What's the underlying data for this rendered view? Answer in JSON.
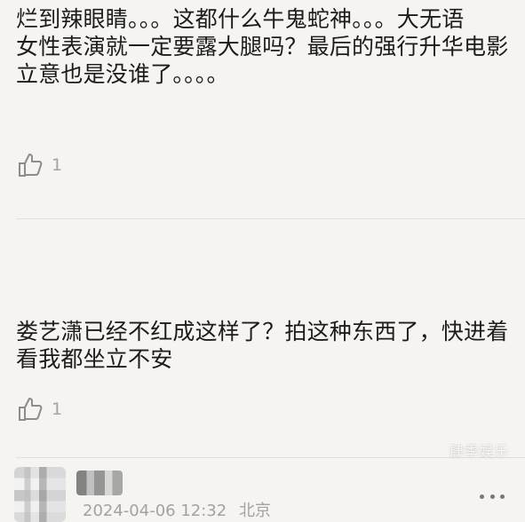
{
  "comments": [
    {
      "text": "烂到辣眼睛。。。这都什么牛鬼蛇神。。。大无语\n女性表演就一定要露大腿吗？最后的强行升华电影立意也是没谁了。。。。",
      "like_count": "1",
      "like_icon": "thumb-up-icon"
    },
    {
      "user": {
        "timestamp": "2024-04-06 12:32",
        "location": "北京"
      },
      "text": "娄艺潇已经不红成这样了？拍这种东西了，快进着看我都坐立不安",
      "like_count": "1",
      "like_icon": "thumb-up-icon",
      "more_icon": "more-icon"
    }
  ],
  "watermark": "肆季娱乐",
  "colors": {
    "background": "#f6f4f1",
    "text": "#1c1c1c",
    "muted": "#a2a2a2",
    "divider": "#e2ded9"
  }
}
